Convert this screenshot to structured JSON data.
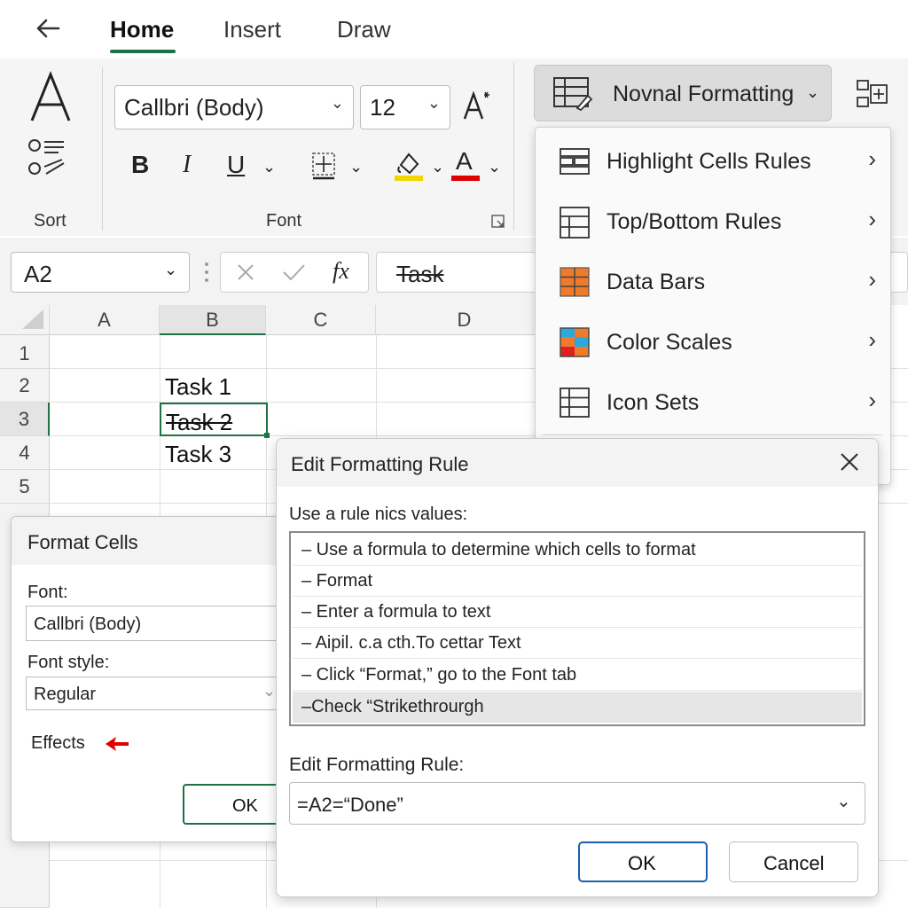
{
  "tabs": {
    "back_icon": "back-arrow-icon",
    "items": [
      {
        "label": "Home",
        "active": true
      },
      {
        "label": "Insert",
        "active": false
      },
      {
        "label": "Draw",
        "active": false
      }
    ]
  },
  "ribbon": {
    "sort_label": "Sort",
    "font_group_label": "Font",
    "font_name": "Callbri (Body)",
    "font_size": "12",
    "bold": "B",
    "italic": "I",
    "underline": "U",
    "font_color_glyph": "A",
    "conditional_formatting_label": "Novnal Formatting"
  },
  "formula_bar": {
    "name_box": "A2",
    "fx": "fx",
    "content": "Task"
  },
  "grid": {
    "columns": [
      "A",
      "B",
      "C",
      "D"
    ],
    "rows": [
      "1",
      "2",
      "3",
      "4",
      "5"
    ],
    "cells": {
      "B2": "Task 1",
      "B3": "Task 2",
      "B4": "Task 3"
    }
  },
  "cf_menu": {
    "items": [
      {
        "label": "Highlight Cells Rules",
        "icon": "highlight-cells-icon"
      },
      {
        "label": "Top/Bottom Rules",
        "icon": "top-bottom-icon"
      },
      {
        "label": "Data Bars",
        "icon": "data-bars-icon"
      },
      {
        "label": "Color Scales",
        "icon": "color-scales-icon"
      },
      {
        "label": "Icon Sets",
        "icon": "icon-sets-icon"
      }
    ]
  },
  "format_cells": {
    "title": "Format Cells",
    "font_label": "Font:",
    "font_value": "Callbri (Body)",
    "style_label": "Font style:",
    "style_value": "Regular",
    "effects_label": "Effects",
    "ok_label": "OK"
  },
  "edit_rule": {
    "title": "Edit Formatting Rule",
    "list_label": "Use a rule nics values:",
    "list_items": [
      "– Use a formula to determine which cells to format",
      "– Format",
      "– Enter a formula to text",
      "–  Aipil. c.a cth.To cettar Text",
      "– Click “Format,” go to the Font tab",
      "–Check “Strikethrourgh"
    ],
    "rule_label": "Edit Formatting Rule:",
    "rule_value": "=A2=“Done”",
    "ok_label": "OK",
    "cancel_label": "Cancel"
  },
  "colors": {
    "accent_green": "#1e7145",
    "ok_border": "#1a5fa8",
    "highlight_yellow": "#f2d600",
    "font_red": "#e00000"
  }
}
